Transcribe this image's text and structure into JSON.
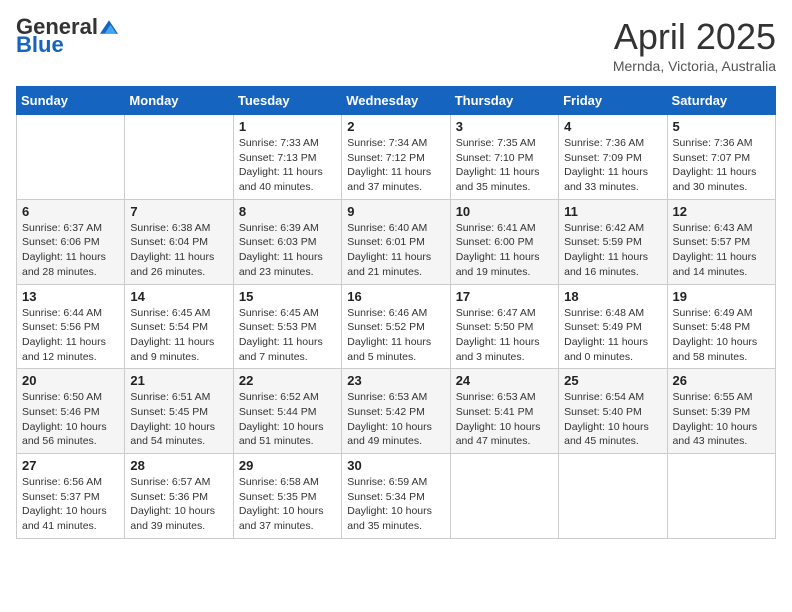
{
  "header": {
    "logo_general": "General",
    "logo_blue": "Blue",
    "month_title": "April 2025",
    "location": "Mernda, Victoria, Australia"
  },
  "days_of_week": [
    "Sunday",
    "Monday",
    "Tuesday",
    "Wednesday",
    "Thursday",
    "Friday",
    "Saturday"
  ],
  "weeks": [
    [
      {
        "day": "",
        "sunrise": "",
        "sunset": "",
        "daylight": ""
      },
      {
        "day": "",
        "sunrise": "",
        "sunset": "",
        "daylight": ""
      },
      {
        "day": "1",
        "sunrise": "Sunrise: 7:33 AM",
        "sunset": "Sunset: 7:13 PM",
        "daylight": "Daylight: 11 hours and 40 minutes."
      },
      {
        "day": "2",
        "sunrise": "Sunrise: 7:34 AM",
        "sunset": "Sunset: 7:12 PM",
        "daylight": "Daylight: 11 hours and 37 minutes."
      },
      {
        "day": "3",
        "sunrise": "Sunrise: 7:35 AM",
        "sunset": "Sunset: 7:10 PM",
        "daylight": "Daylight: 11 hours and 35 minutes."
      },
      {
        "day": "4",
        "sunrise": "Sunrise: 7:36 AM",
        "sunset": "Sunset: 7:09 PM",
        "daylight": "Daylight: 11 hours and 33 minutes."
      },
      {
        "day": "5",
        "sunrise": "Sunrise: 7:36 AM",
        "sunset": "Sunset: 7:07 PM",
        "daylight": "Daylight: 11 hours and 30 minutes."
      }
    ],
    [
      {
        "day": "6",
        "sunrise": "Sunrise: 6:37 AM",
        "sunset": "Sunset: 6:06 PM",
        "daylight": "Daylight: 11 hours and 28 minutes."
      },
      {
        "day": "7",
        "sunrise": "Sunrise: 6:38 AM",
        "sunset": "Sunset: 6:04 PM",
        "daylight": "Daylight: 11 hours and 26 minutes."
      },
      {
        "day": "8",
        "sunrise": "Sunrise: 6:39 AM",
        "sunset": "Sunset: 6:03 PM",
        "daylight": "Daylight: 11 hours and 23 minutes."
      },
      {
        "day": "9",
        "sunrise": "Sunrise: 6:40 AM",
        "sunset": "Sunset: 6:01 PM",
        "daylight": "Daylight: 11 hours and 21 minutes."
      },
      {
        "day": "10",
        "sunrise": "Sunrise: 6:41 AM",
        "sunset": "Sunset: 6:00 PM",
        "daylight": "Daylight: 11 hours and 19 minutes."
      },
      {
        "day": "11",
        "sunrise": "Sunrise: 6:42 AM",
        "sunset": "Sunset: 5:59 PM",
        "daylight": "Daylight: 11 hours and 16 minutes."
      },
      {
        "day": "12",
        "sunrise": "Sunrise: 6:43 AM",
        "sunset": "Sunset: 5:57 PM",
        "daylight": "Daylight: 11 hours and 14 minutes."
      }
    ],
    [
      {
        "day": "13",
        "sunrise": "Sunrise: 6:44 AM",
        "sunset": "Sunset: 5:56 PM",
        "daylight": "Daylight: 11 hours and 12 minutes."
      },
      {
        "day": "14",
        "sunrise": "Sunrise: 6:45 AM",
        "sunset": "Sunset: 5:54 PM",
        "daylight": "Daylight: 11 hours and 9 minutes."
      },
      {
        "day": "15",
        "sunrise": "Sunrise: 6:45 AM",
        "sunset": "Sunset: 5:53 PM",
        "daylight": "Daylight: 11 hours and 7 minutes."
      },
      {
        "day": "16",
        "sunrise": "Sunrise: 6:46 AM",
        "sunset": "Sunset: 5:52 PM",
        "daylight": "Daylight: 11 hours and 5 minutes."
      },
      {
        "day": "17",
        "sunrise": "Sunrise: 6:47 AM",
        "sunset": "Sunset: 5:50 PM",
        "daylight": "Daylight: 11 hours and 3 minutes."
      },
      {
        "day": "18",
        "sunrise": "Sunrise: 6:48 AM",
        "sunset": "Sunset: 5:49 PM",
        "daylight": "Daylight: 11 hours and 0 minutes."
      },
      {
        "day": "19",
        "sunrise": "Sunrise: 6:49 AM",
        "sunset": "Sunset: 5:48 PM",
        "daylight": "Daylight: 10 hours and 58 minutes."
      }
    ],
    [
      {
        "day": "20",
        "sunrise": "Sunrise: 6:50 AM",
        "sunset": "Sunset: 5:46 PM",
        "daylight": "Daylight: 10 hours and 56 minutes."
      },
      {
        "day": "21",
        "sunrise": "Sunrise: 6:51 AM",
        "sunset": "Sunset: 5:45 PM",
        "daylight": "Daylight: 10 hours and 54 minutes."
      },
      {
        "day": "22",
        "sunrise": "Sunrise: 6:52 AM",
        "sunset": "Sunset: 5:44 PM",
        "daylight": "Daylight: 10 hours and 51 minutes."
      },
      {
        "day": "23",
        "sunrise": "Sunrise: 6:53 AM",
        "sunset": "Sunset: 5:42 PM",
        "daylight": "Daylight: 10 hours and 49 minutes."
      },
      {
        "day": "24",
        "sunrise": "Sunrise: 6:53 AM",
        "sunset": "Sunset: 5:41 PM",
        "daylight": "Daylight: 10 hours and 47 minutes."
      },
      {
        "day": "25",
        "sunrise": "Sunrise: 6:54 AM",
        "sunset": "Sunset: 5:40 PM",
        "daylight": "Daylight: 10 hours and 45 minutes."
      },
      {
        "day": "26",
        "sunrise": "Sunrise: 6:55 AM",
        "sunset": "Sunset: 5:39 PM",
        "daylight": "Daylight: 10 hours and 43 minutes."
      }
    ],
    [
      {
        "day": "27",
        "sunrise": "Sunrise: 6:56 AM",
        "sunset": "Sunset: 5:37 PM",
        "daylight": "Daylight: 10 hours and 41 minutes."
      },
      {
        "day": "28",
        "sunrise": "Sunrise: 6:57 AM",
        "sunset": "Sunset: 5:36 PM",
        "daylight": "Daylight: 10 hours and 39 minutes."
      },
      {
        "day": "29",
        "sunrise": "Sunrise: 6:58 AM",
        "sunset": "Sunset: 5:35 PM",
        "daylight": "Daylight: 10 hours and 37 minutes."
      },
      {
        "day": "30",
        "sunrise": "Sunrise: 6:59 AM",
        "sunset": "Sunset: 5:34 PM",
        "daylight": "Daylight: 10 hours and 35 minutes."
      },
      {
        "day": "",
        "sunrise": "",
        "sunset": "",
        "daylight": ""
      },
      {
        "day": "",
        "sunrise": "",
        "sunset": "",
        "daylight": ""
      },
      {
        "day": "",
        "sunrise": "",
        "sunset": "",
        "daylight": ""
      }
    ]
  ]
}
